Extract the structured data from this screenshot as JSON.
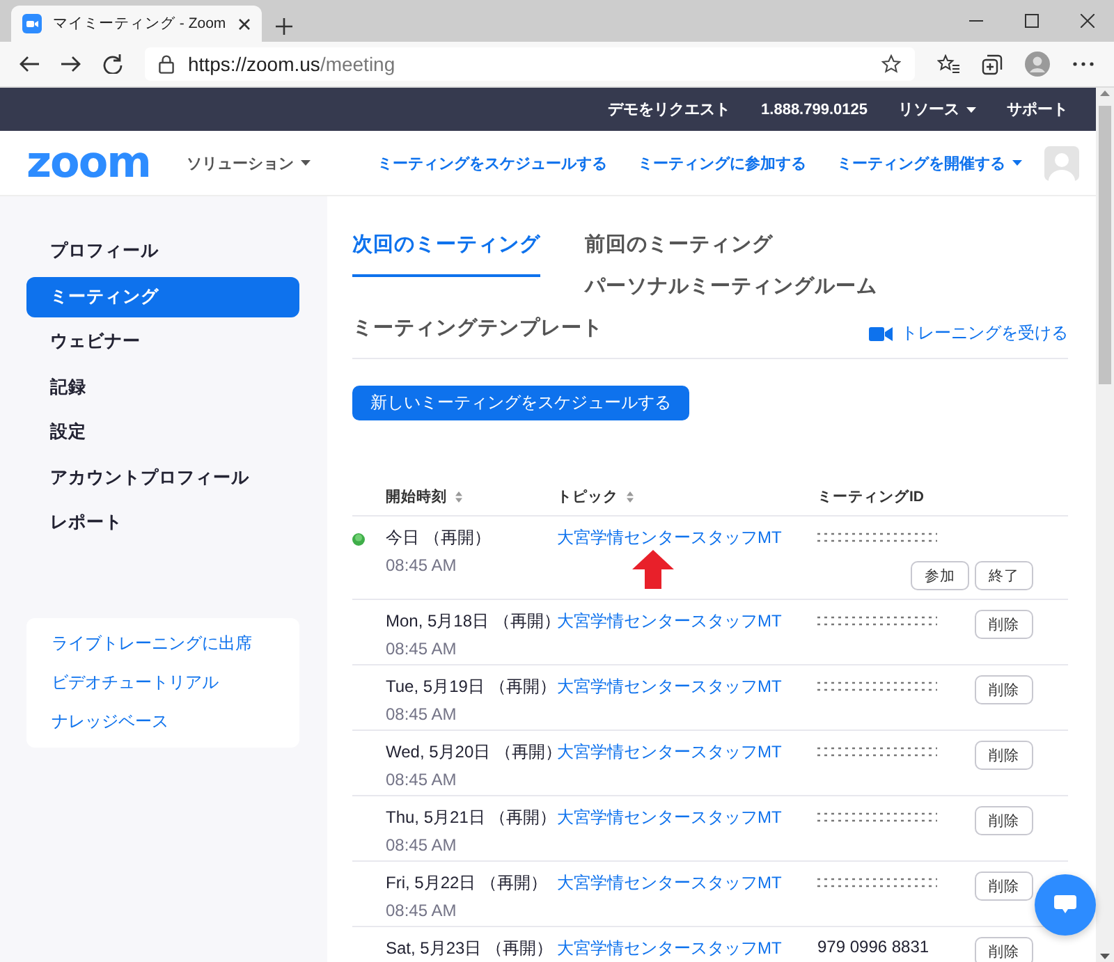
{
  "browser": {
    "tab_title": "マイミーティング - Zoom",
    "url_host": "https://zoom.us",
    "url_path": "/meeting"
  },
  "top_bar": {
    "links": [
      {
        "label": "デモをリクエスト",
        "dropdown": false
      },
      {
        "label": "1.888.799.0125",
        "dropdown": false
      },
      {
        "label": "リソース",
        "dropdown": true
      },
      {
        "label": "サポート",
        "dropdown": false
      }
    ]
  },
  "header": {
    "logo": "zoom",
    "solutions": "ソリューション",
    "links": [
      {
        "label": "ミーティングをスケジュールする",
        "dropdown": false
      },
      {
        "label": "ミーティングに参加する",
        "dropdown": false
      },
      {
        "label": "ミーティングを開催する",
        "dropdown": true
      }
    ]
  },
  "sidebar": {
    "items": [
      {
        "label": "プロフィール",
        "selected": false
      },
      {
        "label": "ミーティング",
        "selected": true
      },
      {
        "label": "ウェビナー",
        "selected": false
      },
      {
        "label": "記録",
        "selected": false
      },
      {
        "label": "設定",
        "selected": false
      },
      {
        "label": "アカウントプロフィール",
        "selected": false
      },
      {
        "label": "レポート",
        "selected": false
      }
    ],
    "links": [
      "ライブトレーニングに出席",
      "ビデオチュートリアル",
      "ナレッジベース"
    ]
  },
  "tabs": [
    {
      "label": "次回のミーティング",
      "selected": true
    },
    {
      "label": "前回のミーティング",
      "selected": false
    },
    {
      "label": "パーソナルミーティングルーム",
      "selected": false
    },
    {
      "label": "ミーティングテンプレート",
      "selected": false
    }
  ],
  "training_link": "トレーニングを受ける",
  "schedule_button": "新しいミーティングをスケジュールする",
  "table": {
    "columns": [
      {
        "label": "開始時刻",
        "sortable": true
      },
      {
        "label": "トピック",
        "sortable": true
      },
      {
        "label": "ミーティングID",
        "sortable": false
      }
    ],
    "rows": [
      {
        "date": "今日 （再開）",
        "time": "08:45 AM",
        "topic": "大宮学情センタースタッフMT",
        "id_masked": true,
        "live": true,
        "arrow": true,
        "buttons": [
          "参加",
          "終了"
        ]
      },
      {
        "date": "Mon, 5月18日 （再開）",
        "time": "08:45 AM",
        "topic": "大宮学情センタースタッフMT",
        "id_masked": true,
        "live": false,
        "arrow": false,
        "buttons": [
          "削除"
        ]
      },
      {
        "date": "Tue, 5月19日 （再開）",
        "time": "08:45 AM",
        "topic": "大宮学情センタースタッフMT",
        "id_masked": true,
        "live": false,
        "arrow": false,
        "buttons": [
          "削除"
        ]
      },
      {
        "date": "Wed, 5月20日 （再開）",
        "time": "08:45 AM",
        "topic": "大宮学情センタースタッフMT",
        "id_masked": true,
        "live": false,
        "arrow": false,
        "buttons": [
          "削除"
        ]
      },
      {
        "date": "Thu, 5月21日 （再開）",
        "time": "08:45 AM",
        "topic": "大宮学情センタースタッフMT",
        "id_masked": true,
        "live": false,
        "arrow": false,
        "buttons": [
          "削除"
        ]
      },
      {
        "date": "Fri, 5月22日 （再開）",
        "time": "08:45 AM",
        "topic": "大宮学情センタースタッフMT",
        "id_masked": true,
        "live": false,
        "arrow": false,
        "buttons": [
          "削除"
        ]
      },
      {
        "date": "Sat, 5月23日 （再開）",
        "meeting_id": "979 0996 8831",
        "topic": "大宮学情センタースタッフMT",
        "id_masked": false,
        "live": false,
        "arrow": false,
        "buttons": [
          "削除"
        ]
      }
    ]
  }
}
